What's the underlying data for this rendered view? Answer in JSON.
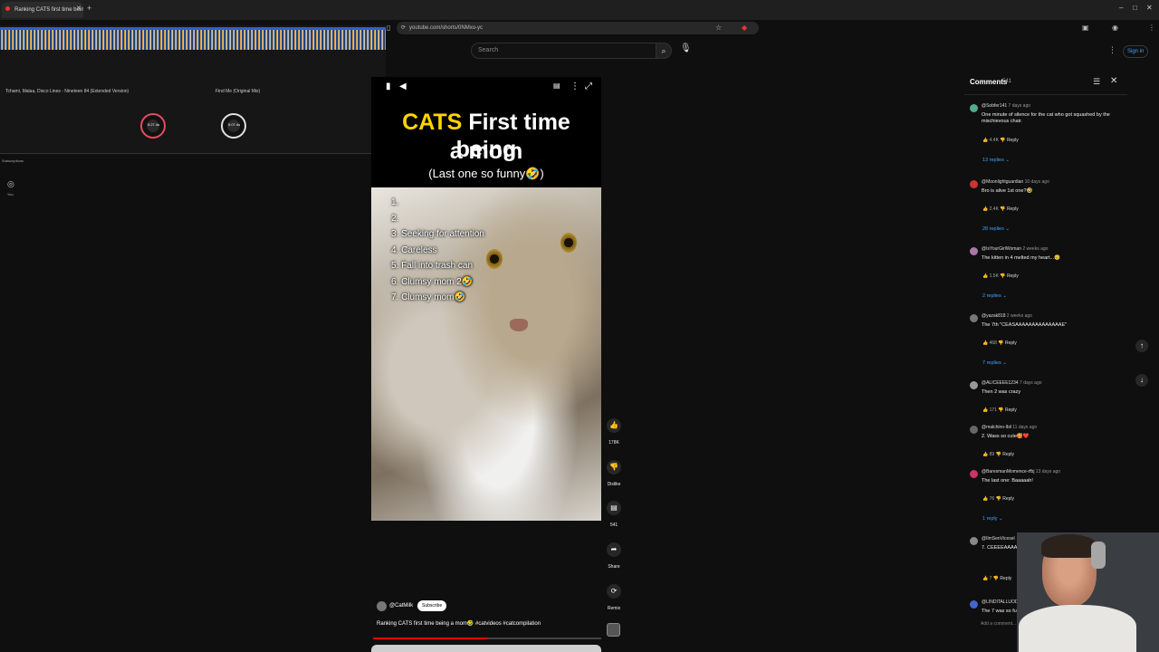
{
  "browser": {
    "tab_title": "Ranking CATS first time bein",
    "url": "youtube.com/shorts/0NMxo-yc",
    "win_minimize": "–",
    "win_maximize": "□",
    "win_close": "✕"
  },
  "dj": {
    "deck1_track": "Tchami, Malaa, Disco Lines - Nineteen 84 (Extended Version)",
    "deck2_track": "Find Me (Original Mix)",
    "jog1_time": "5:27.4s",
    "jog2_time": "5:07.4s"
  },
  "yt_header": {
    "search_placeholder": "Search",
    "sign_in": "Sign in",
    "subscriptions_label": "Subscriptions",
    "you_label": "You"
  },
  "short": {
    "title_cats": "CATS",
    "title_rest_line1": "First time being",
    "title_line2": "a mom",
    "subtitle": "(Last one so funny🤣)",
    "list_items": [
      "1.",
      "2.",
      "3.  Seeking for attention",
      "4.  Careless",
      "5.  Fall into trash can",
      "6.  Clumsy mom 2🤣",
      "7.  Clumsy mom🤣"
    ],
    "channel": "@CatMilk",
    "subscribe": "Subscribe",
    "video_title": "Ranking CATS first time being a mom🤣 #catvideos #catcompilation",
    "progress_fraction": 0.5
  },
  "actions": {
    "like_count": "178K",
    "dislike_label": "Dislike",
    "comments_count": "541",
    "share_label": "Share",
    "remix_label": "Remix"
  },
  "comments": {
    "title": "Comments",
    "count": "541",
    "add_placeholder": "Add a comment...",
    "items": [
      {
        "author": "@Sobfer141",
        "time": "7 days ago",
        "text": "One minute of silence for the cat who got squashed by the mischievous chair.",
        "likes": "4.4K",
        "replies": "13 replies"
      },
      {
        "author": "@Moonlightguardian",
        "time": "10 days ago",
        "text": "Bro is alive 1st one?🤣",
        "likes": "2.4K",
        "replies": "28 replies"
      },
      {
        "author": "@IsYourGirlWoman",
        "time": "2 weeks ago",
        "text": "The kitten in 4 melted my heart...🥺",
        "likes": "1.5K",
        "replies": "2 replies"
      },
      {
        "author": "@yazak818",
        "time": "2 weeks ago",
        "text": "The 7th \"CEASAAAAAAAAAAAAAAE\"",
        "likes": "468",
        "replies": "7 replies"
      },
      {
        "author": "@ALICEEEE1234",
        "time": "7 days ago",
        "text": "Then 2 was crazy",
        "likes": "171",
        "replies": ""
      },
      {
        "author": "@malchino-lbil",
        "time": "11 days ago",
        "text": "2. Wass so cute🥰❤️",
        "likes": "89",
        "replies": ""
      },
      {
        "author": "@BaresmanMomence-rfbj",
        "time": "13 days ago",
        "text": "The last one: Baaaaah!",
        "likes": "76",
        "replies": "1 reply"
      },
      {
        "author": "@IlmSenVicesel",
        "time": "",
        "text": "7. CEEEEAAAAAEE",
        "likes": "7",
        "replies": ""
      },
      {
        "author": "@LINDITALLUOD",
        "time": "",
        "text": "The 7 was so fu",
        "likes": "",
        "replies": ""
      }
    ],
    "reply_label": "Reply"
  }
}
